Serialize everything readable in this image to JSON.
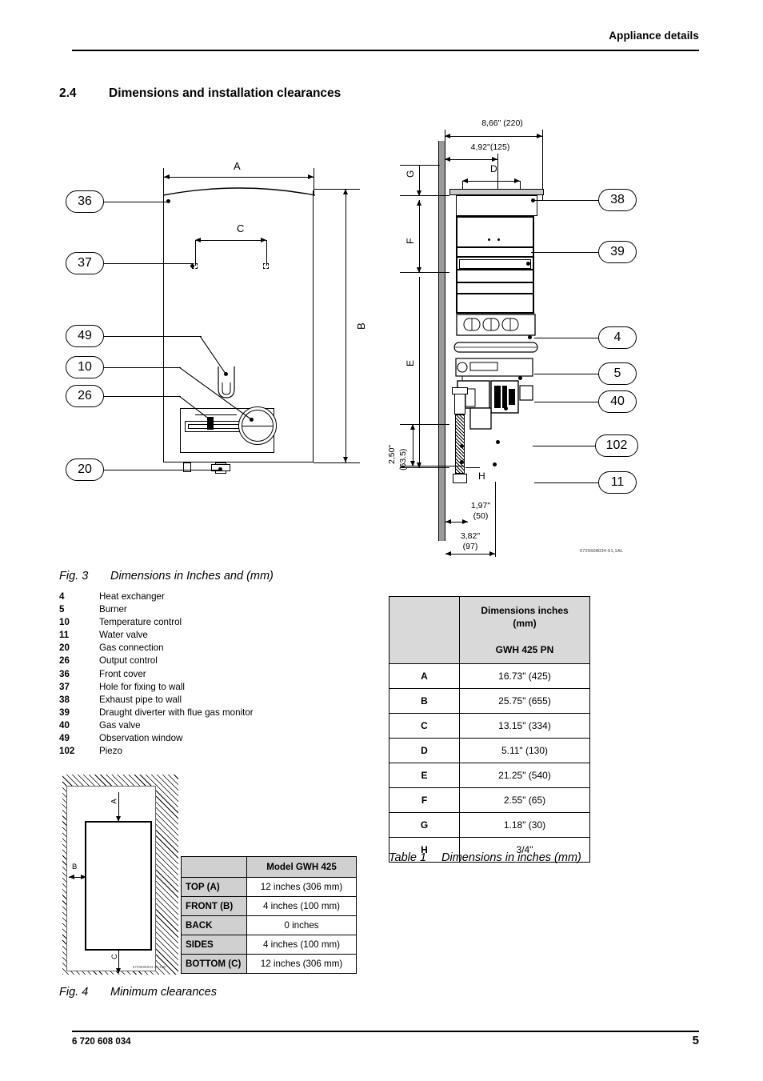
{
  "header": {
    "title": "Appliance details"
  },
  "section": {
    "number": "2.4",
    "title": "Dimensions and installation clearances"
  },
  "figure3": {
    "caption_number": "Fig. 3",
    "caption_text": "Dimensions in Inches and (mm)",
    "drawing_code": "6720608034-01,1AL",
    "front_view": {
      "dimension_labels": {
        "width": "A",
        "height": "B",
        "holes": "C"
      },
      "callouts": [
        "36",
        "37",
        "49",
        "10",
        "26",
        "20"
      ]
    },
    "side_view": {
      "dimension_labels": {
        "g": "G",
        "f": "F",
        "e": "E",
        "d": "D",
        "h": "H"
      },
      "dimensions": {
        "overall_depth": "8,66\" (220)",
        "inner_depth": "4,92\"(125)",
        "outlet_height": "2,50\"\n(63.5)",
        "pipe_offset": "1,97\"\n(50)",
        "base_depth": "3,82\"\n(97)"
      },
      "overall_depth_line1": "8,66\" (220)",
      "inner_depth_line1": "4,92\"(125)",
      "dim_2_50": "2,50\"",
      "dim_63_5": "(63.5)",
      "dim_1_97": "1,97\"",
      "dim_50": "(50)",
      "dim_3_82": "3,82\"",
      "dim_97": "(97)",
      "callouts": [
        "38",
        "39",
        "4",
        "5",
        "40",
        "102",
        "11"
      ]
    }
  },
  "legend": [
    {
      "key": "4",
      "label": "Heat exchanger"
    },
    {
      "key": "5",
      "label": "Burner"
    },
    {
      "key": "10",
      "label": "Temperature control"
    },
    {
      "key": "11",
      "label": "Water valve"
    },
    {
      "key": "20",
      "label": "Gas connection"
    },
    {
      "key": "26",
      "label": "Output control"
    },
    {
      "key": "36",
      "label": "Front cover"
    },
    {
      "key": "37",
      "label": "Hole for fixing to wall"
    },
    {
      "key": "38",
      "label": "Exhaust pipe to wall"
    },
    {
      "key": "39",
      "label": "Draught diverter with flue gas monitor"
    },
    {
      "key": "40",
      "label": "Gas valve"
    },
    {
      "key": "49",
      "label": "Observation window"
    },
    {
      "key": "102",
      "label": "Piezo"
    }
  ],
  "dimensions_table": {
    "header_left": "",
    "header_line1": "Dimensions inches",
    "header_line2": "(mm)",
    "header_line3": "GWH 425 PN",
    "rows": [
      {
        "key": "A",
        "value": "16.73\" (425)"
      },
      {
        "key": "B",
        "value": "25.75\" (655)"
      },
      {
        "key": "C",
        "value": "13.15\" (334)"
      },
      {
        "key": "D",
        "value": "5.11\" (130)"
      },
      {
        "key": "E",
        "value": "21.25\" (540)"
      },
      {
        "key": "F",
        "value": "2.55\" (65)"
      },
      {
        "key": "G",
        "value": "1.18\" (30)"
      },
      {
        "key": "H",
        "value": "3/4\""
      }
    ],
    "caption_number": "Table 1",
    "caption_text": "Dimensions in inches (mm)"
  },
  "clearances_table": {
    "header_left": "",
    "header_right": "Model GWH 425",
    "rows": [
      {
        "key": "TOP (A)",
        "value": "12 inches (306 mm)"
      },
      {
        "key": "FRONT (B)",
        "value": "4 inches (100 mm)"
      },
      {
        "key": "BACK",
        "value": "0 inches"
      },
      {
        "key": "SIDES",
        "value": "4 inches (100 mm)"
      },
      {
        "key": "BOTTOM (C)",
        "value": "12 inches (306 mm)"
      }
    ]
  },
  "figure4": {
    "caption_number": "Fig. 4",
    "caption_text": "Minimum clearances",
    "labels": {
      "top": "A",
      "left": "B",
      "bottom": "C"
    },
    "drawing_code": "6720608034-44,1JB"
  },
  "footer": {
    "doc_number": "6 720 608 034",
    "page_number": "5"
  }
}
